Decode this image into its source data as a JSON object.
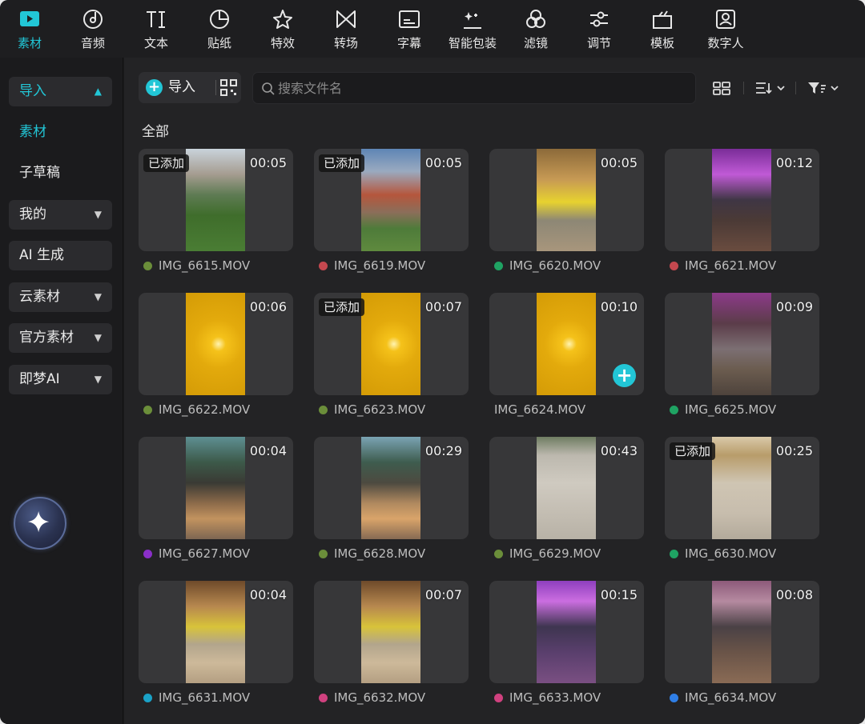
{
  "toolbar": {
    "items": [
      {
        "label": "素材",
        "icon": "media-play-icon",
        "active": true
      },
      {
        "label": "音频",
        "icon": "audio-disc-icon"
      },
      {
        "label": "文本",
        "icon": "text-ti-icon"
      },
      {
        "label": "贴纸",
        "icon": "sticker-icon"
      },
      {
        "label": "特效",
        "icon": "effects-star-icon"
      },
      {
        "label": "转场",
        "icon": "transition-bowtie-icon"
      },
      {
        "label": "字幕",
        "icon": "subtitle-icon"
      },
      {
        "label": "智能包装",
        "icon": "smart-package-icon"
      },
      {
        "label": "滤镜",
        "icon": "filter-circles-icon"
      },
      {
        "label": "调节",
        "icon": "adjust-sliders-icon"
      },
      {
        "label": "模板",
        "icon": "template-icon"
      },
      {
        "label": "数字人",
        "icon": "digital-human-icon"
      }
    ],
    "accent": "#22c6d6"
  },
  "sidebar": {
    "items": [
      {
        "label": "导入",
        "chevron": "⌃"
      },
      {
        "label": "素材"
      },
      {
        "label": "子草稿"
      },
      {
        "label": "我的",
        "chevron": "⌄"
      },
      {
        "label": "AI 生成"
      },
      {
        "label": "云素材",
        "chevron": "⌄"
      },
      {
        "label": "官方素材",
        "chevron": "⌄"
      },
      {
        "label": "即梦AI",
        "chevron": "⌄"
      }
    ]
  },
  "main": {
    "import_label": "导入",
    "search_placeholder": "搜索文件名",
    "section_title": "全部",
    "added_badge": "已添加"
  },
  "media": [
    {
      "name": "IMG_6615.MOV",
      "duration": "00:05",
      "added": true,
      "dot": "#6b8e3a",
      "scene": "garden"
    },
    {
      "name": "IMG_6619.MOV",
      "duration": "00:05",
      "added": true,
      "dot": "#c4484f",
      "scene": "mall"
    },
    {
      "name": "IMG_6620.MOV",
      "duration": "00:05",
      "added": false,
      "dot": "#1fa363",
      "scene": "gold"
    },
    {
      "name": "IMG_6621.MOV",
      "duration": "00:12",
      "added": false,
      "dot": "#c4484f",
      "scene": "purple"
    },
    {
      "name": "IMG_6622.MOV",
      "duration": "00:06",
      "added": false,
      "dot": "#6b8e3a",
      "scene": "yellow"
    },
    {
      "name": "IMG_6623.MOV",
      "duration": "00:07",
      "added": true,
      "dot": "#6b8e3a",
      "scene": "yellow"
    },
    {
      "name": "IMG_6624.MOV",
      "duration": "00:10",
      "added": false,
      "dot": null,
      "scene": "yellow",
      "add_button": true
    },
    {
      "name": "IMG_6625.MOV",
      "duration": "00:09",
      "added": false,
      "dot": "#1fa363",
      "scene": "hall"
    },
    {
      "name": "IMG_6627.MOV",
      "duration": "00:04",
      "added": false,
      "dot": "#8a2fc9",
      "scene": "walk"
    },
    {
      "name": "IMG_6628.MOV",
      "duration": "00:29",
      "added": false,
      "dot": "#6b8e3a",
      "scene": "walk2"
    },
    {
      "name": "IMG_6629.MOV",
      "duration": "00:43",
      "added": false,
      "dot": "#6b8e3a",
      "scene": "plaza"
    },
    {
      "name": "IMG_6630.MOV",
      "duration": "00:25",
      "added": true,
      "dot": "#1fa363",
      "scene": "tiles"
    },
    {
      "name": "IMG_6631.MOV",
      "duration": "00:04",
      "added": false,
      "dot": "#1aa2c7",
      "scene": "sign"
    },
    {
      "name": "IMG_6632.MOV",
      "duration": "00:07",
      "added": false,
      "dot": "#d0417f",
      "scene": "sign"
    },
    {
      "name": "IMG_6633.MOV",
      "duration": "00:15",
      "added": false,
      "dot": "#d0417f",
      "scene": "club"
    },
    {
      "name": "IMG_6634.MOV",
      "duration": "00:08",
      "added": false,
      "dot": "#2f7ee6",
      "scene": "club2"
    }
  ]
}
